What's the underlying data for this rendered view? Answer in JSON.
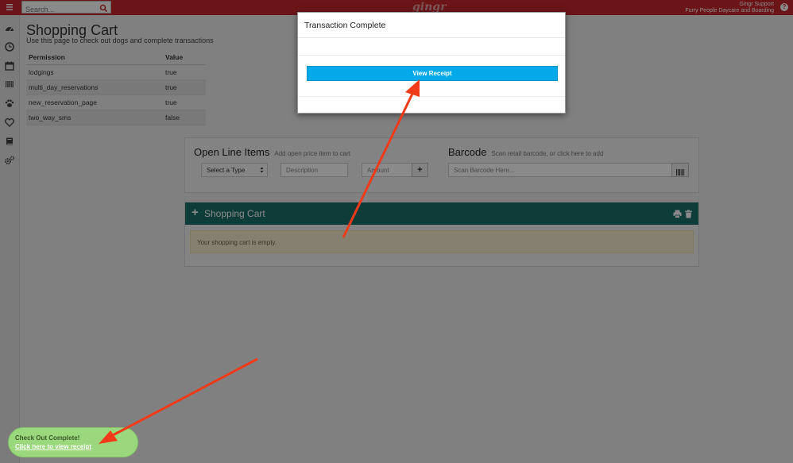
{
  "header": {
    "search_placeholder": "Search...",
    "logo": "gingr",
    "user_name": "Gingr Support",
    "business_name": "Furry People Daycare and Boarding",
    "help_glyph": "?"
  },
  "sidebar": {
    "icons": [
      "dashboard-icon",
      "clock-icon",
      "calendar-icon",
      "barcode-icon",
      "paw-icon",
      "heart-icon",
      "book-icon",
      "gears-icon"
    ]
  },
  "page": {
    "title": "Shopping Cart",
    "subtitle": "Use this page to check out dogs and complete transactions"
  },
  "permissions": {
    "headers": [
      "Permission",
      "Value"
    ],
    "rows": [
      {
        "permission": "lodgings",
        "value": "true"
      },
      {
        "permission": "multi_day_reservations",
        "value": "true"
      },
      {
        "permission": "new_reservation_page",
        "value": "true"
      },
      {
        "permission": "two_way_sms",
        "value": "false"
      }
    ]
  },
  "open_line_items": {
    "title": "Open Line Items",
    "hint": "Add open price item to cart",
    "type_select": "Select a Type",
    "description_placeholder": "Description",
    "amount_placeholder": "Amount",
    "add_label": "+"
  },
  "barcode": {
    "title": "Barcode",
    "hint": "Scan retail barcode, or click here to add",
    "placeholder": "Scan Barcode Here..."
  },
  "cart": {
    "plus": "+",
    "title": "Shopping Cart",
    "empty_message": "Your shopping cart is empty."
  },
  "modal": {
    "title": "Transaction Complete",
    "button_label": "View Receipt"
  },
  "toast": {
    "title": "Check Out Complete!",
    "link": "Click here to view receipt"
  },
  "colors": {
    "topbar": "#c8282d",
    "cart_header": "#1a6f68",
    "button_blue": "#03a9e8",
    "toast_green": "#9bd77c",
    "arrow_red": "#f03a1a"
  }
}
